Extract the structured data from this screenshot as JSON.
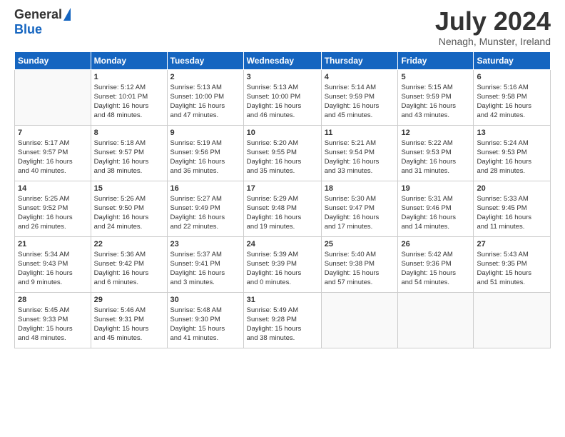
{
  "logo": {
    "general": "General",
    "blue": "Blue"
  },
  "title": "July 2024",
  "location": "Nenagh, Munster, Ireland",
  "days_of_week": [
    "Sunday",
    "Monday",
    "Tuesday",
    "Wednesday",
    "Thursday",
    "Friday",
    "Saturday"
  ],
  "weeks": [
    [
      {
        "day": "",
        "content": ""
      },
      {
        "day": "1",
        "content": "Sunrise: 5:12 AM\nSunset: 10:01 PM\nDaylight: 16 hours\nand 48 minutes."
      },
      {
        "day": "2",
        "content": "Sunrise: 5:13 AM\nSunset: 10:00 PM\nDaylight: 16 hours\nand 47 minutes."
      },
      {
        "day": "3",
        "content": "Sunrise: 5:13 AM\nSunset: 10:00 PM\nDaylight: 16 hours\nand 46 minutes."
      },
      {
        "day": "4",
        "content": "Sunrise: 5:14 AM\nSunset: 9:59 PM\nDaylight: 16 hours\nand 45 minutes."
      },
      {
        "day": "5",
        "content": "Sunrise: 5:15 AM\nSunset: 9:59 PM\nDaylight: 16 hours\nand 43 minutes."
      },
      {
        "day": "6",
        "content": "Sunrise: 5:16 AM\nSunset: 9:58 PM\nDaylight: 16 hours\nand 42 minutes."
      }
    ],
    [
      {
        "day": "7",
        "content": "Sunrise: 5:17 AM\nSunset: 9:57 PM\nDaylight: 16 hours\nand 40 minutes."
      },
      {
        "day": "8",
        "content": "Sunrise: 5:18 AM\nSunset: 9:57 PM\nDaylight: 16 hours\nand 38 minutes."
      },
      {
        "day": "9",
        "content": "Sunrise: 5:19 AM\nSunset: 9:56 PM\nDaylight: 16 hours\nand 36 minutes."
      },
      {
        "day": "10",
        "content": "Sunrise: 5:20 AM\nSunset: 9:55 PM\nDaylight: 16 hours\nand 35 minutes."
      },
      {
        "day": "11",
        "content": "Sunrise: 5:21 AM\nSunset: 9:54 PM\nDaylight: 16 hours\nand 33 minutes."
      },
      {
        "day": "12",
        "content": "Sunrise: 5:22 AM\nSunset: 9:53 PM\nDaylight: 16 hours\nand 31 minutes."
      },
      {
        "day": "13",
        "content": "Sunrise: 5:24 AM\nSunset: 9:53 PM\nDaylight: 16 hours\nand 28 minutes."
      }
    ],
    [
      {
        "day": "14",
        "content": "Sunrise: 5:25 AM\nSunset: 9:52 PM\nDaylight: 16 hours\nand 26 minutes."
      },
      {
        "day": "15",
        "content": "Sunrise: 5:26 AM\nSunset: 9:50 PM\nDaylight: 16 hours\nand 24 minutes."
      },
      {
        "day": "16",
        "content": "Sunrise: 5:27 AM\nSunset: 9:49 PM\nDaylight: 16 hours\nand 22 minutes."
      },
      {
        "day": "17",
        "content": "Sunrise: 5:29 AM\nSunset: 9:48 PM\nDaylight: 16 hours\nand 19 minutes."
      },
      {
        "day": "18",
        "content": "Sunrise: 5:30 AM\nSunset: 9:47 PM\nDaylight: 16 hours\nand 17 minutes."
      },
      {
        "day": "19",
        "content": "Sunrise: 5:31 AM\nSunset: 9:46 PM\nDaylight: 16 hours\nand 14 minutes."
      },
      {
        "day": "20",
        "content": "Sunrise: 5:33 AM\nSunset: 9:45 PM\nDaylight: 16 hours\nand 11 minutes."
      }
    ],
    [
      {
        "day": "21",
        "content": "Sunrise: 5:34 AM\nSunset: 9:43 PM\nDaylight: 16 hours\nand 9 minutes."
      },
      {
        "day": "22",
        "content": "Sunrise: 5:36 AM\nSunset: 9:42 PM\nDaylight: 16 hours\nand 6 minutes."
      },
      {
        "day": "23",
        "content": "Sunrise: 5:37 AM\nSunset: 9:41 PM\nDaylight: 16 hours\nand 3 minutes."
      },
      {
        "day": "24",
        "content": "Sunrise: 5:39 AM\nSunset: 9:39 PM\nDaylight: 16 hours\nand 0 minutes."
      },
      {
        "day": "25",
        "content": "Sunrise: 5:40 AM\nSunset: 9:38 PM\nDaylight: 15 hours\nand 57 minutes."
      },
      {
        "day": "26",
        "content": "Sunrise: 5:42 AM\nSunset: 9:36 PM\nDaylight: 15 hours\nand 54 minutes."
      },
      {
        "day": "27",
        "content": "Sunrise: 5:43 AM\nSunset: 9:35 PM\nDaylight: 15 hours\nand 51 minutes."
      }
    ],
    [
      {
        "day": "28",
        "content": "Sunrise: 5:45 AM\nSunset: 9:33 PM\nDaylight: 15 hours\nand 48 minutes."
      },
      {
        "day": "29",
        "content": "Sunrise: 5:46 AM\nSunset: 9:31 PM\nDaylight: 15 hours\nand 45 minutes."
      },
      {
        "day": "30",
        "content": "Sunrise: 5:48 AM\nSunset: 9:30 PM\nDaylight: 15 hours\nand 41 minutes."
      },
      {
        "day": "31",
        "content": "Sunrise: 5:49 AM\nSunset: 9:28 PM\nDaylight: 15 hours\nand 38 minutes."
      },
      {
        "day": "",
        "content": ""
      },
      {
        "day": "",
        "content": ""
      },
      {
        "day": "",
        "content": ""
      }
    ]
  ]
}
